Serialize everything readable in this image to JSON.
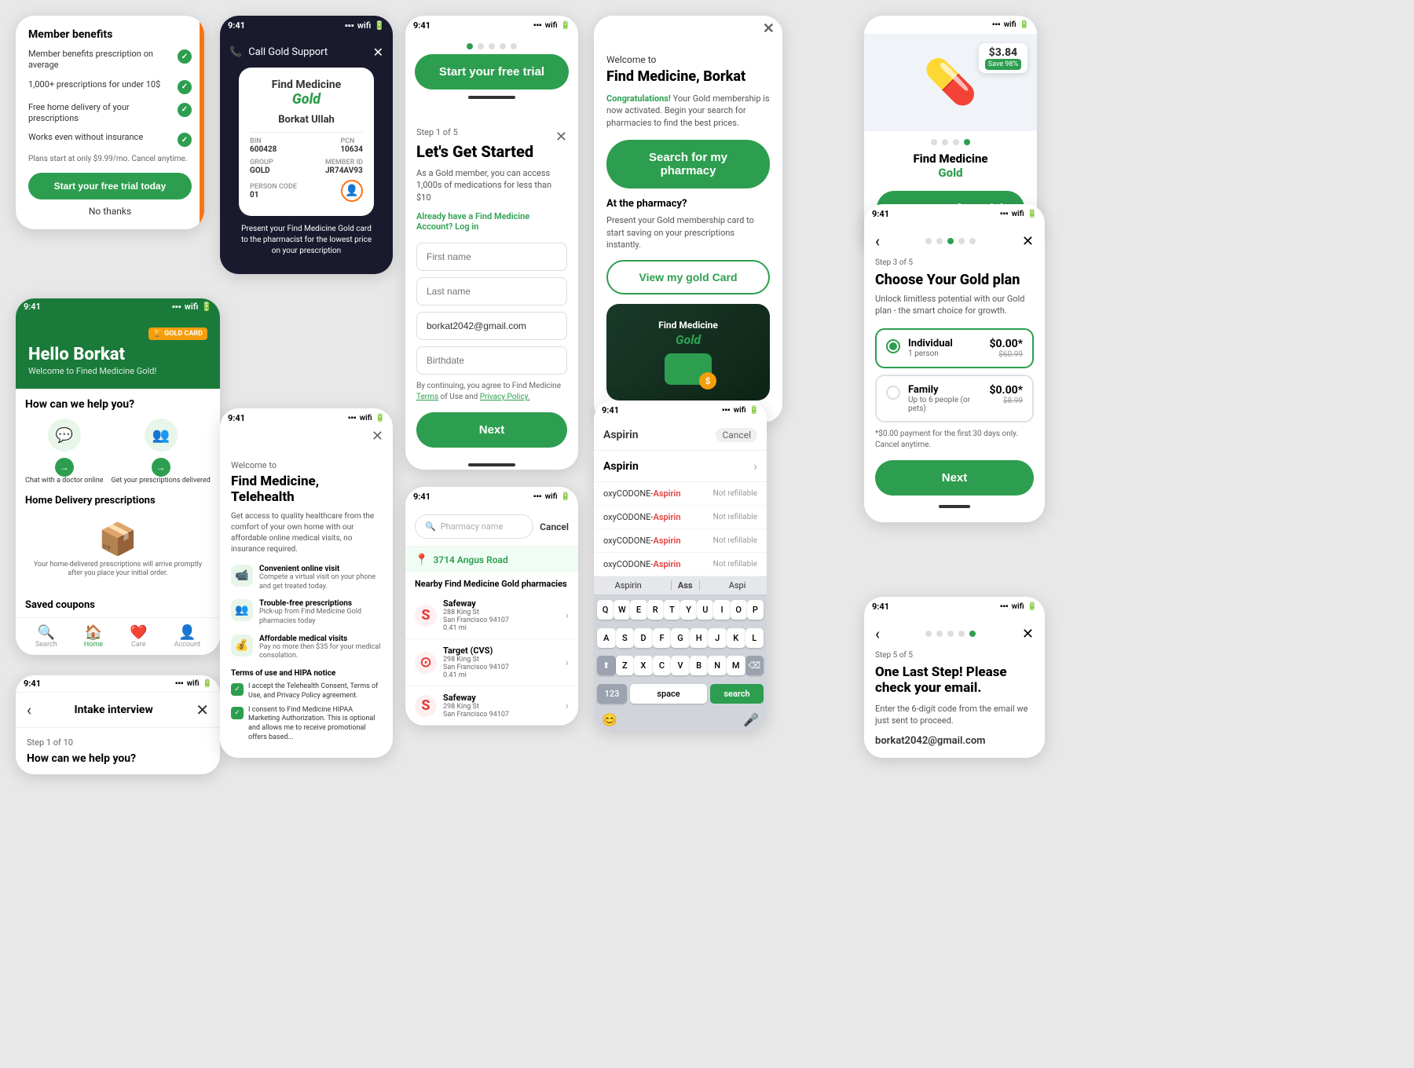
{
  "app": {
    "name": "Find Medicine",
    "brand_color": "#2d9e4f",
    "time": "9:41"
  },
  "card_member_benefits": {
    "title": "Member benefits",
    "items": [
      "Member benefits prescription on average",
      "1,000+ prescriptions for under 10$",
      "Free home delivery of your prescriptions",
      "Works even without insurance"
    ],
    "plans_text": "Plans start at only $9.99/mo. Cancel anytime.",
    "cta_label": "Start your free trial today",
    "secondary_label": "No thanks"
  },
  "card_hello": {
    "badge": "GOLD CARD",
    "greeting": "Hello Borkat",
    "subtitle": "Welcome to Fined Medicine Gold!",
    "how_help": "How can we help you?",
    "help_items": [
      {
        "label": "Chat with a doctor online",
        "icon": "💬"
      },
      {
        "label": "Get your prescriptions delivered",
        "icon": "👥"
      }
    ],
    "home_delivery": "Home Delivery prescriptions",
    "box_text": "Your home-delivered prescriptions will arrive promptly after you place your initial order.",
    "saved_coupons": "Saved coupons",
    "nav": [
      "Search",
      "Home",
      "Care",
      "Account"
    ]
  },
  "card_intake": {
    "title": "Intake interview",
    "step": "Step 1 of 10",
    "header": "How can we help you?"
  },
  "card_fm_gold_card": {
    "title": "Find Medicine",
    "gold_label": "Gold",
    "member_name": "Borkat Ullah",
    "bin_label": "BIN",
    "bin_value": "600428",
    "pcn_label": "PCN",
    "pcn_value": "10634",
    "group_label": "GROUP",
    "group_value": "GOLD",
    "member_id_label": "MEMBER ID",
    "member_id_value": "JR74AV93",
    "person_code_label": "PERSON CODE",
    "person_code_value": "01",
    "present_text": "Present your Find Medicine Gold card to the pharmacist for the lowest price on your prescription"
  },
  "card_telehealth": {
    "welcome_to": "Welcome to",
    "title": "Find Medicine, Telehealth",
    "desc": "Get access to quality healthcare from the comfort of your own home with our affordable online medical visits, no insurance required.",
    "features": [
      {
        "title": "Convenient online visit",
        "desc": "Compete a virtual visit on your phone and get treated today.",
        "icon": "📹"
      },
      {
        "title": "Trouble-free prescriptions",
        "desc": "Pick-up from Find Medicine Gold pharmacies today",
        "icon": "👥"
      },
      {
        "title": "Affordable medical visits",
        "desc": "Pay no more then $35 for your medical consolation.",
        "icon": "💰"
      }
    ],
    "terms_title": "Terms of use and HIPA notice",
    "checkboxes": [
      "I accept the Telehealth Consent, Terms of Use, and Privacy Policy agreement.",
      "I consent to Find Medicine HIPAA Marketing Authorization. This is optional and allows me to receive promotional offers based..."
    ]
  },
  "card_get_started": {
    "progress_dots": 5,
    "active_dot": 0,
    "step_label": "Step 1 of 5",
    "title": "Let's Get Started",
    "desc": "As a Gold member, you can access 1,000s of medications for less than $10",
    "account_question": "Already have a Find Medicine Account?",
    "log_in_label": "Log in",
    "fields": {
      "first_name": "First name",
      "last_name": "Last name",
      "email": "borkat2042@gmail.com",
      "birthdate": "Birthdate"
    },
    "terms_text": "By continuing, you agree to Find Medicine Terms of Use and Privacy Policy.",
    "cta_label": "Next",
    "trial_label": "Start your free trial"
  },
  "card_pharmacy_search": {
    "search_placeholder": "Pharmacy name",
    "cancel_label": "Cancel",
    "location": "3714 Angus Road",
    "nearby_title": "Nearby Find Medicine Gold pharmacies",
    "pharmacies": [
      {
        "name": "Safeway",
        "address": "288 King St",
        "city": "San Francisco 94107",
        "distance": "0.41 mi",
        "color": "#e53e3e"
      },
      {
        "name": "Target (CVS)",
        "address": "298 King St",
        "city": "San Francisco 94107",
        "distance": "0.41 mi",
        "color": "#e53e3e"
      },
      {
        "name": "Safeway",
        "address": "298 King St",
        "city": "San Francisco 94107",
        "distance": "",
        "color": "#e53e3e"
      }
    ]
  },
  "card_welcome_borkat": {
    "welcome_to": "Welcome to",
    "title": "Find Medicine, Borkat",
    "congrats_label": "Congratulations!",
    "congrats_text": " Your Gold membership is now activated. Begin your search for pharmacies to find the best prices.",
    "search_label": "Search for my pharmacy",
    "at_pharmacy_title": "At the pharmacy?",
    "at_pharmacy_desc": "Present your Gold membership card to start saving on your prescriptions instantly.",
    "view_card_label": "View my gold Card"
  },
  "card_aspirin": {
    "search_text": "Aspirin",
    "cancel_label": "Cancel",
    "drug_name": "Aspirin",
    "drug_items": [
      {
        "name": "oxyCODONE-Aspirin",
        "highlight": "Aspirin",
        "status": "Not refillable"
      },
      {
        "name": "oxyCODONE-Aspirin",
        "highlight": "Aspirin",
        "status": "Not refillable"
      },
      {
        "name": "oxyCODONE-Aspirin",
        "highlight": "Aspirin",
        "status": "Not refillable"
      },
      {
        "name": "oxyCODONE-Aspirin",
        "highlight": "Aspirin",
        "status": "Not refillable"
      }
    ],
    "suggestions": [
      "Aspirin",
      "Ass",
      "Aspi"
    ],
    "keyboard_rows": [
      [
        "Q",
        "W",
        "E",
        "R",
        "T",
        "Y",
        "U",
        "I",
        "O",
        "P"
      ],
      [
        "A",
        "S",
        "D",
        "F",
        "G",
        "H",
        "J",
        "K",
        "L"
      ],
      [
        "Z",
        "X",
        "C",
        "V",
        "B",
        "N",
        "M"
      ]
    ],
    "space_label": "space",
    "search_label": "search"
  },
  "card_fm_gold_top_right": {
    "price": "$3.84",
    "save_label": "Save 98%",
    "dots": 4,
    "active_dot": 3,
    "title_line1": "Find Medicine",
    "title_gold": "Gold",
    "cta_label": "Start your free trial"
  },
  "card_gold_plan": {
    "step_label": "Step 3 of 5",
    "title": "Choose Your Gold plan",
    "desc": "Unlock limitless potential with our Gold plan - the smart choice for growth.",
    "plans": [
      {
        "name": "Individual",
        "sub": "1 person",
        "price": "$0.00*",
        "original": "$60.99",
        "selected": true
      },
      {
        "name": "Family",
        "sub": "Up to 6 people (or pets)",
        "price": "$0.00*",
        "original": "$8.99",
        "selected": false
      }
    ],
    "note": "*$0.00 payment for the first 30 days only. Cancel anytime.",
    "cta_label": "Next"
  },
  "card_email_verify": {
    "step_label": "Step 5 of 5",
    "title": "One Last Step! Please check your email.",
    "desc": "Enter the 6-digit code from the email we just sent to proceed.",
    "email": "borkat2042@gmail.com"
  }
}
